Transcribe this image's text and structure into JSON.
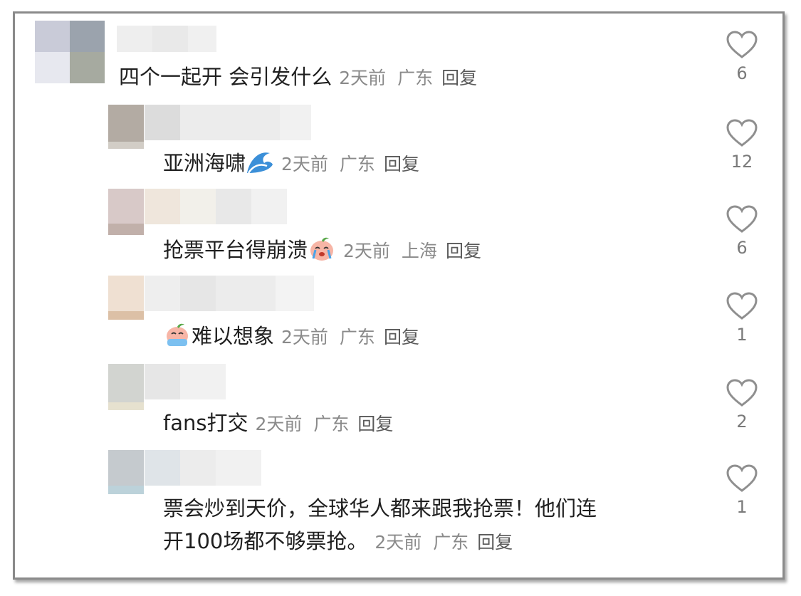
{
  "comments": [
    {
      "text": "四个一起开 会引发什么",
      "time": "2天前",
      "location": "广东",
      "reply": "回复",
      "likes": "6",
      "emoji": ""
    },
    {
      "text": "亚洲海啸",
      "time": "2天前",
      "location": "广东",
      "reply": "回复",
      "likes": "12",
      "emoji": "wave-emoji"
    },
    {
      "text": "抢票平台得崩溃",
      "time": "2天前",
      "location": "上海",
      "reply": "回复",
      "likes": "6",
      "emoji": "crying-peach-emoji"
    },
    {
      "text": "难以想象",
      "time": "2天前",
      "location": "广东",
      "reply": "回复",
      "likes": "1",
      "emoji": "crying-peach-emoji"
    },
    {
      "text": "fans打交",
      "time": "2天前",
      "location": "广东",
      "reply": "回复",
      "likes": "2",
      "emoji": ""
    },
    {
      "text_line1": "票会炒到天价，全球华人都来跟我抢票！他们连",
      "text_line2": "开100场都不够票抢。",
      "time": "2天前",
      "location": "广东",
      "reply": "回复",
      "likes": "1",
      "emoji": ""
    }
  ],
  "icons": {
    "like": "heart-outline-icon"
  },
  "colors": {
    "text": "#1f1f1f",
    "meta": "#8a8a8a",
    "heart": "#8f8f8f"
  }
}
